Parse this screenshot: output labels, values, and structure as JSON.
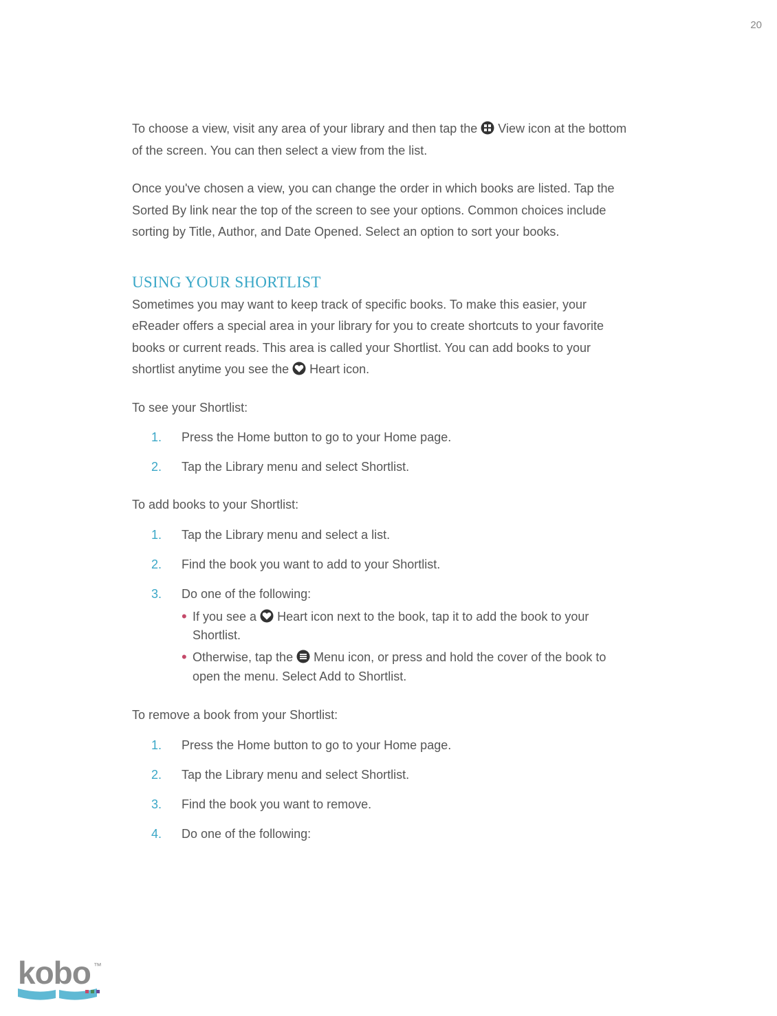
{
  "pageNumber": "20",
  "para1_a": "To choose a view, visit any area of your library and then tap the ",
  "para1_b": " View icon at the bottom of the screen. You can then select a view from the list.",
  "para2": "Once you've chosen a view, you can change the order in which books are listed. Tap the Sorted By link near the top of the screen to see your options. Common choices include sorting by Title, Author, and Date Opened. Select an option to sort your books.",
  "heading1": "USING YOUR SHORTLIST",
  "para3_a": "Sometimes you may want to keep track of specific books. To make this easier, your eReader offers a special area in your library for you to create shortcuts to your favorite books or current reads. This area is called your Shortlist. You can add books to your shortlist anytime you see the ",
  "para3_b": " Heart icon.",
  "listIntro1": "To see your Shortlist:",
  "stepsA": {
    "n1": "1.",
    "t1": "Press the Home button to go to your Home page.",
    "n2": "2.",
    "t2": "Tap the Library menu and select Shortlist."
  },
  "listIntro2": "To add books to your Shortlist:",
  "stepsB": {
    "n1": "1.",
    "t1": "Tap the Library menu and select a list.",
    "n2": "2.",
    "t2": "Find the book you want to add to your Shortlist.",
    "n3": "3.",
    "t3": "Do one of the following:",
    "b1_a": "If you see a ",
    "b1_b": " Heart icon next to the book, tap it to add the book to your Shortlist.",
    "b2_a": "Otherwise, tap the ",
    "b2_b": " Menu icon, or press and hold the cover of the book to open the menu. Select Add to Shortlist."
  },
  "listIntro3": "To remove a book from your Shortlist:",
  "stepsC": {
    "n1": "1.",
    "t1": "Press the Home button to go to your Home page.",
    "n2": "2.",
    "t2": "Tap the Library menu and select Shortlist.",
    "n3": "3.",
    "t3": "Find the book you want to remove.",
    "n4": "4.",
    "t4": "Do one of the following:"
  },
  "logo": {
    "text": "kobo",
    "tm": "™"
  }
}
